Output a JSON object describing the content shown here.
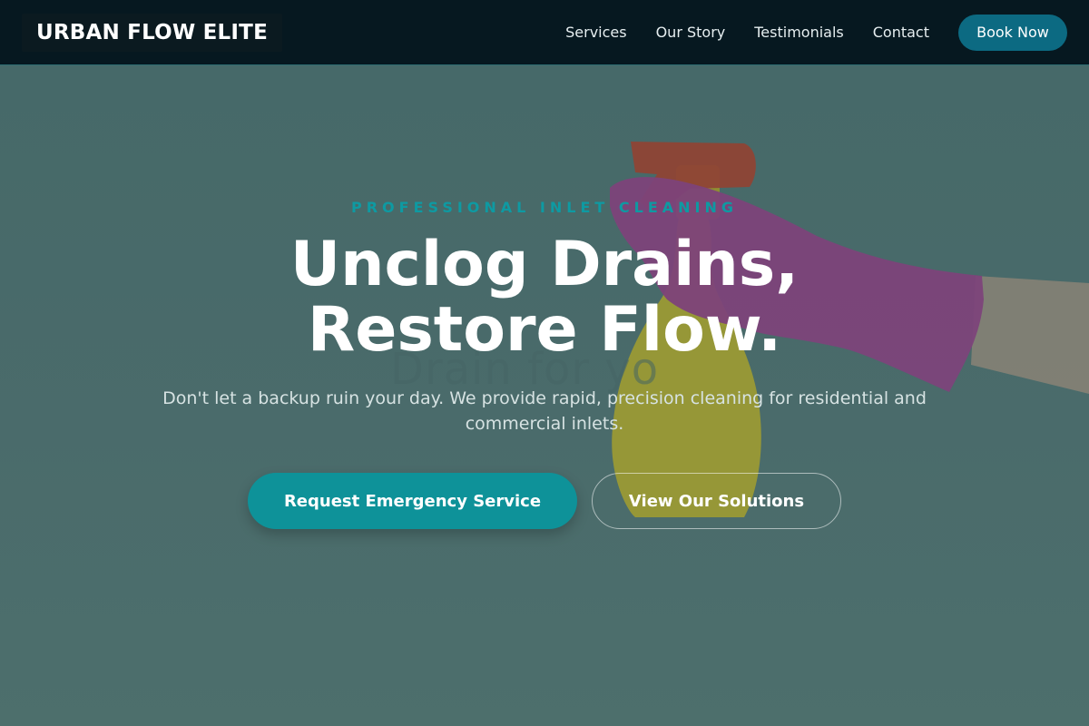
{
  "header": {
    "logo": "URBAN FLOW ELITE",
    "nav": [
      "Services",
      "Our Story",
      "Testimonials",
      "Contact"
    ],
    "book_label": "Book Now"
  },
  "hero": {
    "eyebrow": "PROFESSIONAL INLET CLEANING",
    "headline_line1": "Unclog Drains,",
    "headline_line2": "Restore Flow.",
    "ghost_text": "Drain for yo",
    "subtext": "Don't let a backup ruin your day. We provide rapid, precision cleaning for residential and commercial inlets.",
    "primary_cta": "Request Emergency Service",
    "secondary_cta": "View Our Solutions",
    "image": "gloved-hand-spray-bottle"
  },
  "colors": {
    "header_bg": "#061820",
    "accent": "#0e9299",
    "book_btn": "#0c6a82",
    "eyebrow": "#0e9aa2",
    "hero_bg": "#4e6e6e"
  }
}
